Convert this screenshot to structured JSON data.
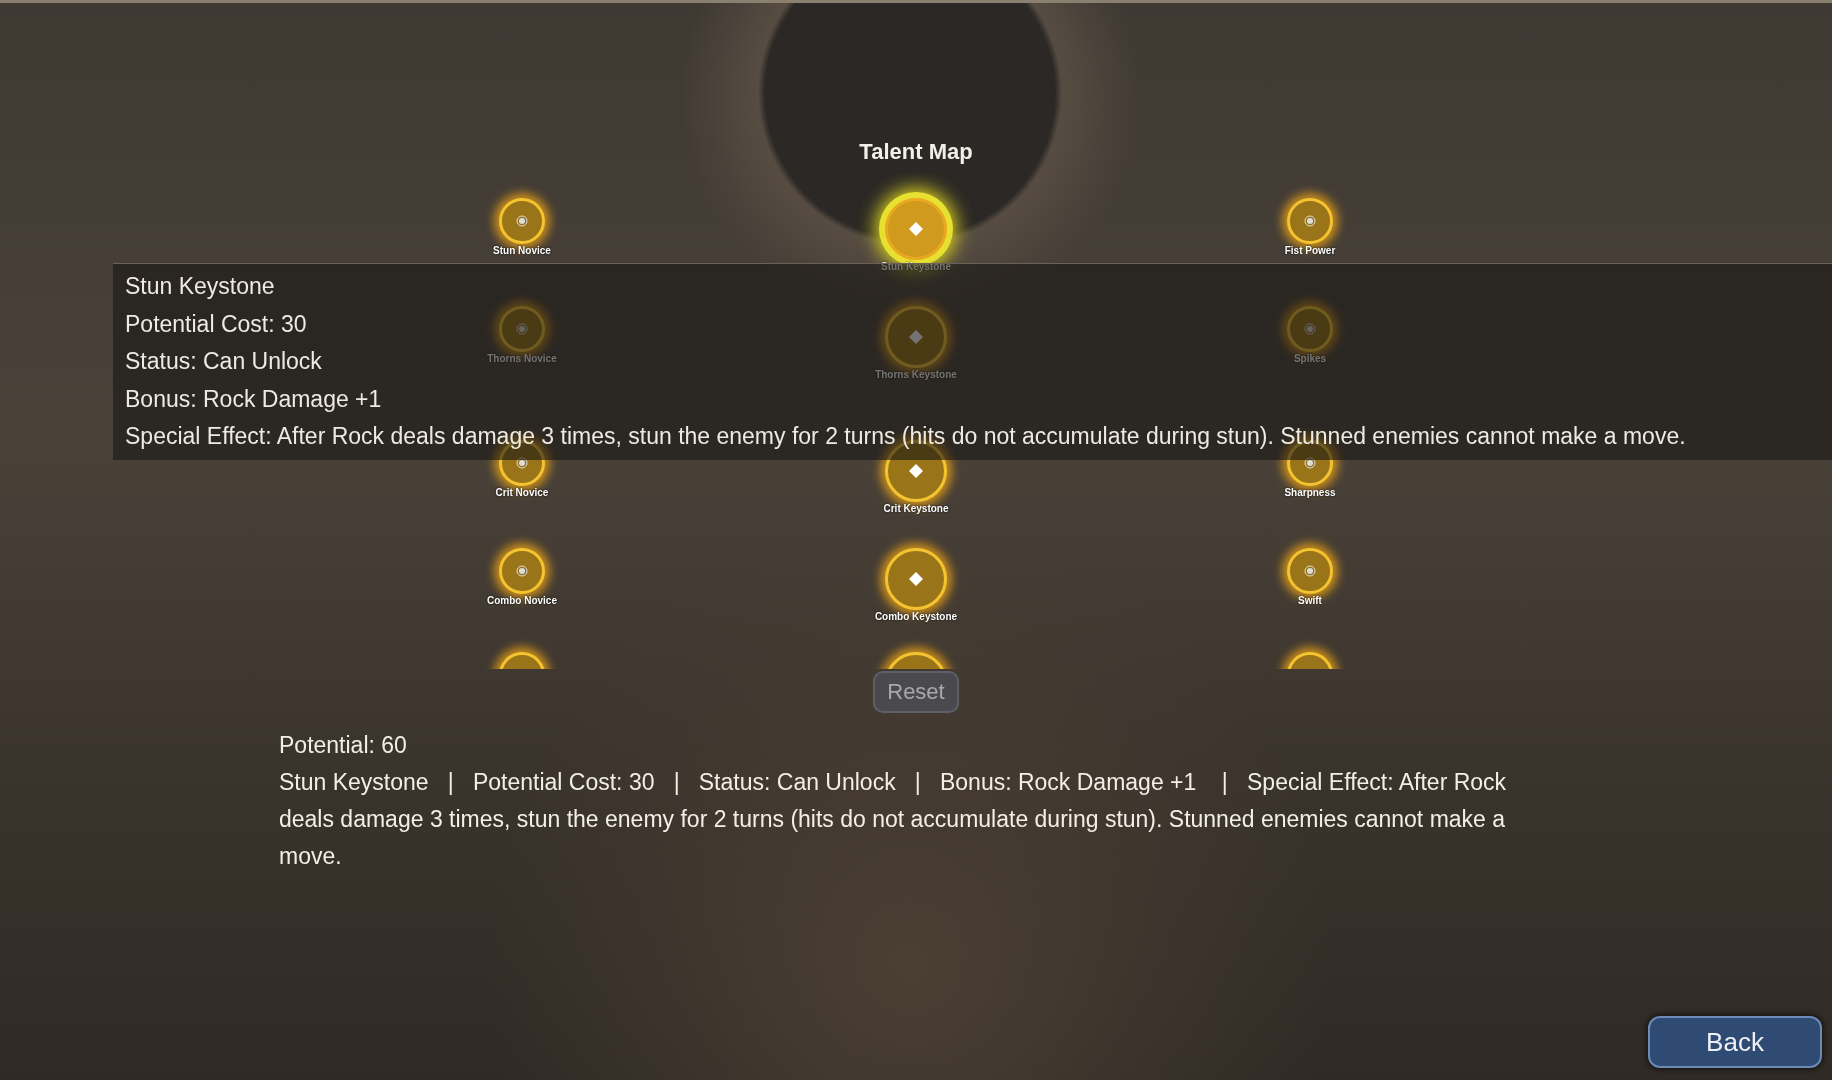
{
  "title": "Talent Map",
  "nodes": [
    {
      "label": "Stun Novice",
      "kind": "novice",
      "selected": false
    },
    {
      "label": "Stun Keystone",
      "kind": "keystone",
      "selected": true
    },
    {
      "label": "Fist Power",
      "kind": "novice",
      "selected": false
    },
    {
      "label": "Thorns Novice",
      "kind": "novice",
      "selected": false
    },
    {
      "label": "Thorns Keystone",
      "kind": "keystone",
      "selected": false
    },
    {
      "label": "Spikes",
      "kind": "novice",
      "selected": false
    },
    {
      "label": "Crit Novice",
      "kind": "novice",
      "selected": false
    },
    {
      "label": "Crit Keystone",
      "kind": "keystone",
      "selected": false
    },
    {
      "label": "Sharpness",
      "kind": "novice",
      "selected": false
    },
    {
      "label": "Combo Novice",
      "kind": "novice",
      "selected": false
    },
    {
      "label": "Combo Keystone",
      "kind": "keystone",
      "selected": false
    },
    {
      "label": "Swift",
      "kind": "novice",
      "selected": false
    },
    {
      "kind": "novice",
      "selected": false
    },
    {
      "kind": "keystone",
      "selected": false
    },
    {
      "kind": "novice",
      "selected": false
    }
  ],
  "tooltip": [
    "Stun Keystone",
    "Potential Cost: 30",
    "Status: Can Unlock",
    "Bonus: Rock Damage +1",
    "Special Effect: After Rock deals damage 3 times, stun the enemy for 2 turns (hits do not accumulate during stun). Stunned enemies cannot make a move."
  ],
  "reset_button": "Reset",
  "potential": "Potential: 60",
  "details": "Stun Keystone   |   Potential Cost: 30   |   Status: Can Unlock   |   Bonus: Rock Damage +1    |   Special Effect: After Rock deals damage 3 times, stun the enemy for 2 turns (hits do not accumulate during stun). Stunned enemies cannot make a move.",
  "back_button": "Back"
}
